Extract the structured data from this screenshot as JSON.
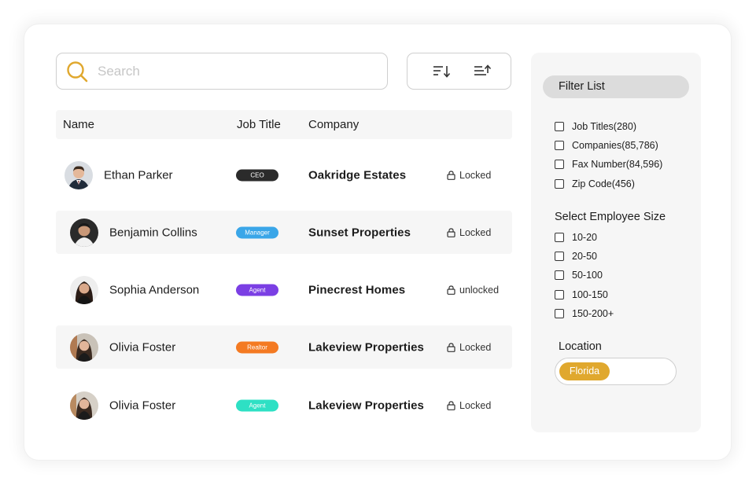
{
  "search": {
    "placeholder": "Search"
  },
  "table": {
    "headers": {
      "name": "Name",
      "job_title": "Job Title",
      "company": "Company"
    },
    "rows": [
      {
        "name": "Ethan Parker",
        "badge": "CEO",
        "badge_color": "#2b2b2b",
        "company": "Oakridge Estates",
        "status": "Locked",
        "avatar": "man-suit-avatar"
      },
      {
        "name": "Benjamin Collins",
        "badge": "Manager",
        "badge_color": "#3aa6e8",
        "company": "Sunset Properties",
        "status": "Locked",
        "avatar": "man-avatar"
      },
      {
        "name": "Sophia Anderson",
        "badge": "Agent",
        "badge_color": "#7b3fe4",
        "company": "Pinecrest Homes",
        "status": "unlocked",
        "avatar": "woman-avatar"
      },
      {
        "name": "Olivia Foster",
        "badge": "Realtor",
        "badge_color": "#f47a22",
        "company": "Lakeview Properties",
        "status": "Locked",
        "avatar": "woman-avatar"
      },
      {
        "name": "Olivia Foster",
        "badge": "Agent",
        "badge_color": "#2ee0c4",
        "company": "Lakeview Properties",
        "status": "Locked",
        "avatar": "woman-avatar"
      }
    ]
  },
  "filters": {
    "title": "Filter List",
    "items": [
      "Job Titles(280)",
      "Companies(85,786)",
      "Fax Number(84,596)",
      "Zip Code(456)"
    ],
    "employee_size_title": "Select Employee Size",
    "employee_sizes": [
      "10-20",
      "20-50",
      "50-100",
      "100-150",
      "150-200+"
    ],
    "location_title": "Location",
    "location_value": "Florida"
  },
  "colors": {
    "accent": "#e0a82e",
    "panel_bg": "#f6f6f6"
  },
  "icons": {
    "search": "search-icon",
    "sort_desc": "sort-descending-icon",
    "sort_asc": "sort-ascending-icon",
    "lock": "lock-icon"
  }
}
